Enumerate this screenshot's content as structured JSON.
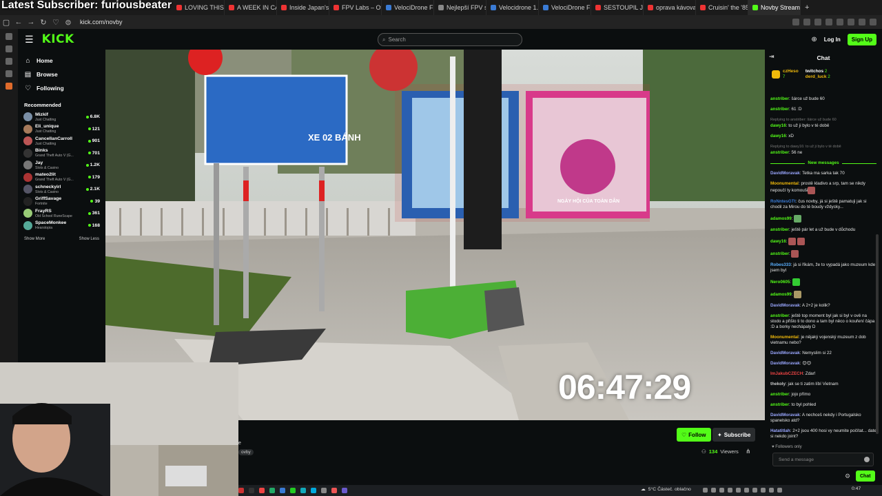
{
  "overlay_title": "Latest Subscriber: furiousbeater",
  "browser": {
    "tabs": [
      {
        "label": "LOVING THIS LIF",
        "color": "#e33"
      },
      {
        "label": "A WEEK IN CAPE",
        "color": "#e33"
      },
      {
        "label": "Inside Japan's Illi",
        "color": "#e33"
      },
      {
        "label": "FPV Labs – Officia",
        "color": "#e33"
      },
      {
        "label": "VelociDrone FPV",
        "color": "#3a7bd5"
      },
      {
        "label": "Nejlepší FPV sim",
        "color": "#888"
      },
      {
        "label": "Velocidrone 1.7 D",
        "color": "#3a7bd5"
      },
      {
        "label": "VelociDrone FPV",
        "color": "#3a7bd5"
      },
      {
        "label": "SESTOUPIL JSEM",
        "color": "#e33"
      },
      {
        "label": "oprava kávovaru",
        "color": "#e33"
      },
      {
        "label": "Cruisin' the '85 F",
        "color": "#e33"
      },
      {
        "label": "Novby Stream",
        "color": "#53fc18",
        "active": true
      }
    ],
    "url": "kick.com/novby"
  },
  "topnav": {
    "logo": "KICK",
    "search_placeholder": "Search",
    "login": "Log In",
    "signup": "Sign Up"
  },
  "leftnav": {
    "main": [
      {
        "label": "Home",
        "icon": "home-icon"
      },
      {
        "label": "Browse",
        "icon": "browse-icon"
      },
      {
        "label": "Following",
        "icon": "heart-icon"
      }
    ],
    "recommended_title": "Recommended",
    "recommended": [
      {
        "name": "Mizkif",
        "category": "Just Chatting",
        "viewers": "6.8K",
        "color": "#7a8fa6"
      },
      {
        "name": "Eli_unique",
        "category": "Just Chatting",
        "viewers": "121",
        "color": "#a67a5b"
      },
      {
        "name": "CancellanCarroll",
        "category": "Just Chatting",
        "viewers": "901",
        "color": "#b55"
      },
      {
        "name": "Binks",
        "category": "Grand Theft Auto V (G...",
        "viewers": "701",
        "color": "#333"
      },
      {
        "name": "Jay",
        "category": "Slots & Casino",
        "viewers": "1.2K",
        "color": "#777"
      },
      {
        "name": "mateo2lit",
        "category": "Grand Theft Auto V (G...",
        "viewers": "179",
        "color": "#a33"
      },
      {
        "name": "schneckyirl",
        "category": "Slots & Casino",
        "viewers": "2.1K",
        "color": "#556"
      },
      {
        "name": "GriffSavage",
        "category": "Fortnite",
        "viewers": "39",
        "color": "#222"
      },
      {
        "name": "FrayRS",
        "category": "Old School RuneScape",
        "viewers": "361",
        "color": "#9c7"
      },
      {
        "name": "SpaceMonkee",
        "category": "Hearstopia",
        "viewers": "168",
        "color": "#5a9"
      }
    ],
    "show_more": "Show More",
    "show_less": "Show Less"
  },
  "video": {
    "timer": "06:47:29",
    "sign_text": "XE 02 BÁNH",
    "poster_text": "NGÀY HỘI CỦA TOÀN DÂN"
  },
  "stream_info": {
    "name_fragment": "e",
    "tag_fragment": "ovby",
    "follow": "Follow",
    "subscribe": "Subscribe",
    "viewers_count": "134",
    "viewers_label": "Viewers"
  },
  "chat": {
    "title": "Chat",
    "pinned": {
      "user": "czHeso",
      "count": "7",
      "right_user1": "twitchos",
      "right_count1": "2",
      "right_user2": "derd_luck",
      "right_count2": "2"
    },
    "messages_before": [
      {
        "user": "anstriber",
        "color": "#53fc18",
        "text": "šárce už bude 60"
      },
      {
        "user": "anstriber",
        "color": "#53fc18",
        "text": "61 :D"
      },
      {
        "reply": "Replying to anstriber: šárce už bude 60",
        "user": "dawy16",
        "color": "#53fc18",
        "text": "to už ji bylo v té době"
      },
      {
        "user": "dawy16",
        "color": "#53fc18",
        "text": "xD"
      },
      {
        "reply": "Replying to dawy16: to už ji bylo v té době",
        "user": "anstriber",
        "color": "#53fc18",
        "text": "56 ne"
      }
    ],
    "new_messages_label": "New messages",
    "messages_after": [
      {
        "user": "DavidMoravak",
        "color": "#9aa7ff",
        "text": "Tetka ma sarka tak 70"
      },
      {
        "user": "Moonumental",
        "color": "#f0b90b",
        "text": "prostě kladivo a srp, tam se nikdy nepoučí ty komouši",
        "emote": "#a55"
      },
      {
        "user": "RoNntesGTt",
        "color": "#3a7bd5",
        "text": "čus novby, já si ještě pamatuji jak si chodil za Mirou do té boudy vždycky..."
      },
      {
        "user": "adamos99",
        "color": "#53fc18",
        "text": "",
        "emote": "#6a6"
      },
      {
        "user": "anstriber",
        "color": "#53fc18",
        "text": "ještě pár let a už bude v důchodu"
      },
      {
        "user": "dawy16",
        "color": "#53fc18",
        "text": "",
        "emote": "#a55",
        "emote2": "#a55"
      },
      {
        "user": "anstriber",
        "color": "#53fc18",
        "text": "",
        "emote": "#a55"
      },
      {
        "user": "Robes333",
        "color": "#5ab0ff",
        "text": "já si říkám, že to vypadá jako muzeum kde jsem byl"
      },
      {
        "user": "Nero0605",
        "color": "#53fc18",
        "text": "",
        "emote": "#3c3"
      },
      {
        "user": "adamos99",
        "color": "#53fc18",
        "text": "",
        "emote": "#a96"
      },
      {
        "user": "DavidMoravak",
        "color": "#9aa7ff",
        "text": "A 2+2 je kolik?"
      },
      {
        "user": "anstriber",
        "color": "#53fc18",
        "text": "ještě top moment byl jak si byl v ově na stodo a přišlo ti to dono a tam byl něco o kouření čápa :D a borky nechápaly D"
      },
      {
        "user": "Moonumental",
        "color": "#f0b90b",
        "text": "je nějaký vojenský muzeum z dob vietnamu nebo?"
      },
      {
        "user": "DavidMoravak",
        "color": "#9aa7ff",
        "text": "Nemyslim si 22"
      },
      {
        "user": "DavidMoravak",
        "color": "#9aa7ff",
        "text": "😊😊"
      },
      {
        "user": "ImJakubCZECH",
        "color": "#e44",
        "text": "Zdar!"
      },
      {
        "user": "thekoly",
        "color": "#ccc",
        "text": "jak se ti zatim líbí Vietnam"
      },
      {
        "user": "anstriber",
        "color": "#53fc18",
        "text": "jojo přímo"
      },
      {
        "user": "anstriber",
        "color": "#53fc18",
        "text": "to byl pohled"
      },
      {
        "user": "DavidMoravak",
        "color": "#9aa7ff",
        "text": "A nechceš nekdy i Portugalsko spanelsko atd?"
      },
      {
        "user": "Hatatitlah",
        "color": "#9aa7ff",
        "text": "2+2 jsou 400 hosi vy neumite počítat... date si nekdo joint?"
      }
    ],
    "followers_only": "Followers only",
    "send_placeholder": "Send a message",
    "chat_button": "Chat"
  },
  "taskbar": {
    "weather": "5°C  Částeč. oblačno",
    "time": "0:47"
  }
}
